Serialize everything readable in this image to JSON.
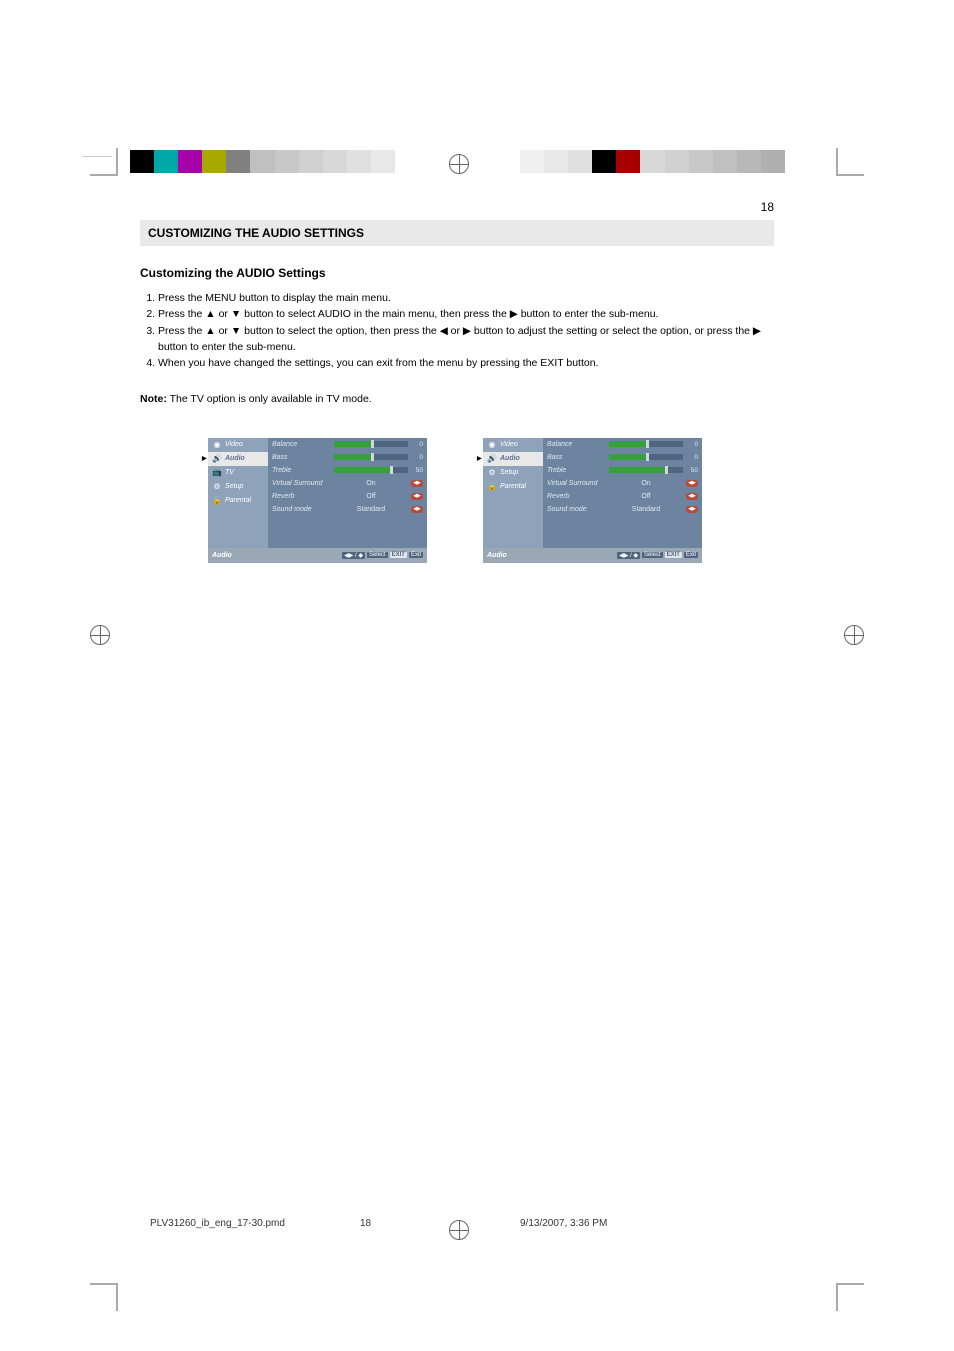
{
  "page": {
    "number_top": "18",
    "title_bar": "CUSTOMIZING THE AUDIO SETTINGS",
    "heading": "Customizing the AUDIO Settings",
    "steps": [
      "Press the MENU button to display the main menu.",
      "Press the ▲ or ▼ button to select AUDIO in the main menu, then press the ▶ button to enter the sub-menu.",
      "Press the ▲ or ▼ button to select the option, then press the ◀ or ▶ button to adjust the setting or select the option, or press the ▶ button to enter the sub-menu.",
      "When you have changed the settings, you can exit from the menu by pressing the EXIT button."
    ],
    "note_label": "Note:",
    "note_text": "The TV option is only available in TV mode."
  },
  "osd": {
    "sidebar": {
      "video": "Video",
      "audio": "Audio",
      "tv": "TV",
      "setup": "Setup",
      "parental": "Parental"
    },
    "items": {
      "balance": {
        "label": "Balance",
        "value": 0,
        "pos": 50
      },
      "bass": {
        "label": "Bass",
        "value": 0,
        "pos": 50
      },
      "treble": {
        "label": "Treble",
        "value": 50,
        "pos": 75
      },
      "virtual_surround": {
        "label": "Virtual Surround",
        "value": "On"
      },
      "reverb": {
        "label": "Reverb",
        "value": "Off"
      },
      "sound_mode": {
        "label": "Sound mode",
        "value": "Standard"
      }
    },
    "footer": {
      "section": "Audio",
      "nav1": "◀▶ / ◆",
      "select": "Select",
      "exit1": "EXIT",
      "exit2": "Exit"
    }
  },
  "print": {
    "file": "PLV31260_ib_eng_17-30.pmd",
    "page": "18",
    "datetime": "9/13/2007, 3:36 PM"
  },
  "regbar_colors_left": [
    "#000",
    "#00a8a8",
    "#a800a8",
    "#a8a800",
    "#808080",
    "#c0c0c0",
    "#c8c8c8",
    "#d0d0d0",
    "#d8d8d8",
    "#e0e0e0",
    "#e8e8e8"
  ],
  "regbar_colors_right": [
    "#f0f0f0",
    "#e8e8e8",
    "#e0e0e0",
    "#000",
    "#a80000",
    "#d8d8d8",
    "#d0d0d0",
    "#c8c8c8",
    "#c0c0c0",
    "#b8b8b8",
    "#b0b0b0"
  ]
}
